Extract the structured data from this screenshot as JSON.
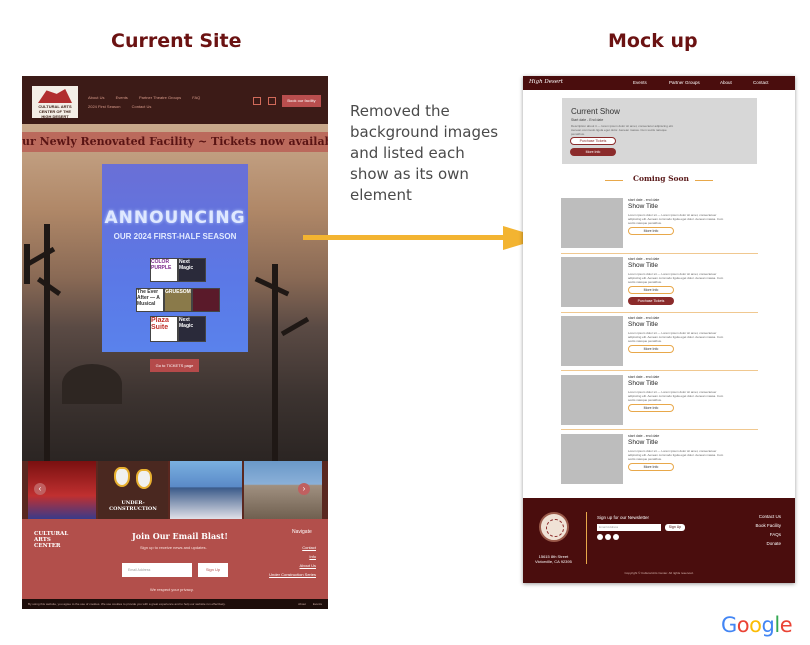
{
  "headings": {
    "left": "Current Site",
    "right": "Mock up"
  },
  "note": "Removed the background images and listed each show as its own element",
  "current_site": {
    "logo_text": "CULTURAL ARTS CENTER OF THE HIGH DESERT",
    "nav_links": [
      "About Us",
      "Events",
      "Partner Theatre Groups",
      "FAQ",
      "2024 First Season",
      "Contact Us"
    ],
    "book_button": "Book our facility",
    "ticker": "ur Newly Renovated Facility  ~  Tickets now available for our",
    "poster": {
      "title": "ANNOUNCING",
      "subtitle": "OUR 2024 FIRST-HALF SEASON",
      "shows": [
        "COLOR PURPLE",
        "Next Magic",
        "The Ever After — A Musical",
        "GRUESOME",
        "Plaza Suite",
        "Next Magic"
      ]
    },
    "tickets_button": "Go to TICKETS page",
    "gallery_caption": "UNDER-CONSTRUCTION",
    "footer": {
      "logo": "CULTURAL ARTS CENTER",
      "blast_title": "Join Our Email Blast!",
      "blast_sub": "Sign up to receive news and updates.",
      "email_placeholder": "Email Address",
      "signup": "Sign Up",
      "privacy": "We respect your privacy.",
      "nav_heading": "Navigate",
      "nav_links": [
        "Contact",
        "Info",
        "About Us",
        "Under Construction Series"
      ],
      "bottom": "By using this website, you agree to the use of cookies. We use cookies to provide you with a great experience and to help our website run effectively.",
      "bottom_right": [
        "About",
        "Events"
      ]
    }
  },
  "mockup": {
    "brand": "High Desert",
    "nav": [
      "Events",
      "Partner Groups",
      "About",
      "Contact"
    ],
    "current_show": {
      "title": "Current Show",
      "date": "Start date - End date",
      "desc": "Description about it — lorem ipsum dolor sit amet, consectetur adipiscing elit. Aenean commodo ligula eget dolor. Aenean massa. Cum sociis natoque penatibus.",
      "buy": "Purchase Tickets",
      "info": "More Info"
    },
    "coming_soon": "Coming Soon",
    "shows": [
      {
        "date": "start date - end date",
        "title": "Show Title",
        "desc": "Lorem ipsum dolor sit — Lorem ipsum dolor sit amet, consectetuer adipiscing elit. Aenean commodo ligula eget dolor. Aenean massa. Cum sociis natoque penatibus.",
        "info": "More Info"
      },
      {
        "date": "start date - end date",
        "title": "Show Title",
        "desc": "Lorem ipsum dolor sit — Lorem ipsum dolor sit amet, consectetuer adipiscing elit. Aenean commodo ligula eget dolor. Aenean massa. Cum sociis natoque penatibus.",
        "info": "More Info",
        "buy": "Purchase Tickets"
      },
      {
        "date": "start date - end date",
        "title": "Show Title",
        "desc": "Lorem ipsum dolor sit — Lorem ipsum dolor sit amet, consectetuer adipiscing elit. Aenean commodo ligula eget dolor. Aenean massa. Cum sociis natoque penatibus.",
        "info": "More Info"
      },
      {
        "date": "start date - end date",
        "title": "Show Title",
        "desc": "Lorem ipsum dolor sit — Lorem ipsum dolor sit amet, consectetuer adipiscing elit. Aenean commodo ligula eget dolor. Aenean massa. Cum sociis natoque penatibus.",
        "info": "More Info"
      },
      {
        "date": "start date - end date",
        "title": "Show Title",
        "desc": "Lorem ipsum dolor sit — Lorem ipsum dolor sit amet, consectetuer adipiscing elit. Aenean commodo ligula eget dolor. Aenean massa. Cum sociis natoque penatibus.",
        "info": "More Info"
      }
    ],
    "footer": {
      "address": [
        "15615 8th Street",
        "Victorville, CA 92395"
      ],
      "newsletter": "Sign up for our Newsletter",
      "email_placeholder": "Email Address",
      "signup": "Sign Up",
      "links": [
        "Contact Us",
        "Book Facility",
        "FAQs",
        "Donate"
      ],
      "copyright": "Copyright © Cultural Arts Center. All rights reserved."
    }
  },
  "watermark": "Google",
  "colors": {
    "heading": "#6b1212",
    "arrow": "#f3b431",
    "maroon": "#4a0d0d",
    "accent": "#e8a84a"
  }
}
